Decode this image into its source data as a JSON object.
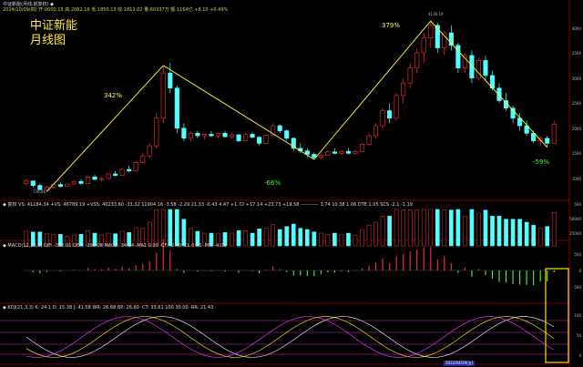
{
  "header": {
    "main_info": "中证新能(月线,前复权) ◆",
    "main_row2": "2024/10/09(四) 开:0000.15 高:2062.16 低:1850.13 收:1813.02 量:60337万 额:1164亿 +8.10 +0.49%",
    "vol_info": "◆ 复权 VS: 41184.34 +VS: 46789.19 +VSS: 40233.60 -33.32 11904.16 -3.58 -2.29 21.33 -0.43 4.47 +1.72 +17.14 +23.73 +19.58 ----------- 3.74 10.38 1.06 DTE 1.05 SCS -2.1 -1.19",
    "macd_info": "◆ MACD(12,26,9) DIF: -382.01 DEA: -399.08 MACD: 34.14 ·MA1 0.00 ·CF: -2.40 ·CL 0.00 ·MK: -4.05",
    "kdj_info": "◆ KDJ(21,3,3) K: 24.1 D: 15.38 J: 41.58 WR: 26.68 BP: 26.60 ·CT: 33.61 100 30.00 ·RR: 21.43"
  },
  "chart_title": {
    "line1": "中证新能",
    "line2": "月线图"
  },
  "annotations": {
    "up1": "342%",
    "up2": "379%",
    "down1": "-66%",
    "down2": "-59%",
    "low_label": "736.66",
    "high_label": "4136.19"
  },
  "axis": {
    "price_ticks": [
      "4000",
      "3500",
      "3000",
      "2500",
      "2000",
      "1500",
      "1000",
      "500"
    ],
    "vol_ticks": [
      "50000",
      "25000"
    ],
    "macd_ticks": [
      "500",
      "0",
      "-500"
    ],
    "kdj_ticks": [
      "100",
      "50",
      "0"
    ],
    "date_label": "2022/04/29(五)"
  },
  "colors": {
    "up": "#ff3030",
    "down": "#54ffff",
    "trend": "#ffff40",
    "grid": "#7a0000",
    "highlight": "#ffe000"
  },
  "chart_data": {
    "type": "candlestick",
    "series_ohlc_note": "monthly candles, estimated",
    "ohlc": [
      [
        900,
        1000,
        850,
        950
      ],
      [
        950,
        960,
        820,
        860
      ],
      [
        860,
        900,
        760,
        780
      ],
      [
        780,
        850,
        737,
        830
      ],
      [
        830,
        900,
        800,
        880
      ],
      [
        880,
        920,
        820,
        840
      ],
      [
        840,
        900,
        830,
        890
      ],
      [
        890,
        960,
        870,
        940
      ],
      [
        940,
        980,
        880,
        900
      ],
      [
        900,
        1050,
        890,
        1030
      ],
      [
        1030,
        1080,
        960,
        980
      ],
      [
        980,
        1020,
        930,
        1000
      ],
      [
        1000,
        1100,
        980,
        1090
      ],
      [
        1090,
        1150,
        1040,
        1060
      ],
      [
        1060,
        1200,
        1050,
        1180
      ],
      [
        1180,
        1250,
        1120,
        1150
      ],
      [
        1150,
        1350,
        1140,
        1320
      ],
      [
        1320,
        1500,
        1300,
        1450
      ],
      [
        1450,
        1700,
        1400,
        1650
      ],
      [
        1650,
        2300,
        1600,
        2200
      ],
      [
        2200,
        3250,
        2100,
        3100
      ],
      [
        3100,
        3300,
        2700,
        2800
      ],
      [
        2800,
        2850,
        1900,
        2000
      ],
      [
        2000,
        2100,
        1750,
        1800
      ],
      [
        1800,
        1950,
        1750,
        1900
      ],
      [
        1900,
        1950,
        1800,
        1850
      ],
      [
        1850,
        1900,
        1780,
        1880
      ],
      [
        1880,
        1950,
        1830,
        1850
      ],
      [
        1850,
        1920,
        1800,
        1900
      ],
      [
        1900,
        1950,
        1820,
        1830
      ],
      [
        1830,
        1900,
        1780,
        1870
      ],
      [
        1870,
        1880,
        1720,
        1750
      ],
      [
        1750,
        1900,
        1740,
        1880
      ],
      [
        1880,
        1920,
        1800,
        1820
      ],
      [
        1820,
        1840,
        1650,
        1700
      ],
      [
        1700,
        1880,
        1680,
        1860
      ],
      [
        1860,
        2100,
        1840,
        2050
      ],
      [
        2050,
        2080,
        1900,
        1950
      ],
      [
        1950,
        1980,
        1750,
        1800
      ],
      [
        1800,
        1820,
        1550,
        1600
      ],
      [
        1600,
        1700,
        1500,
        1550
      ],
      [
        1550,
        1600,
        1420,
        1480
      ],
      [
        1480,
        1520,
        1380,
        1420
      ],
      [
        1420,
        1500,
        1380,
        1460
      ],
      [
        1460,
        1550,
        1450,
        1530
      ],
      [
        1530,
        1600,
        1480,
        1500
      ],
      [
        1500,
        1560,
        1460,
        1540
      ],
      [
        1540,
        1600,
        1480,
        1500
      ],
      [
        1500,
        1560,
        1480,
        1540
      ],
      [
        1540,
        1700,
        1520,
        1680
      ],
      [
        1680,
        1900,
        1650,
        1850
      ],
      [
        1850,
        2100,
        1800,
        2050
      ],
      [
        2050,
        2400,
        2000,
        2350
      ],
      [
        2350,
        2500,
        2100,
        2200
      ],
      [
        2200,
        2700,
        2150,
        2650
      ],
      [
        2650,
        3000,
        2500,
        2900
      ],
      [
        2900,
        3300,
        2800,
        3200
      ],
      [
        3200,
        3600,
        3100,
        3500
      ],
      [
        3500,
        3900,
        3300,
        3800
      ],
      [
        3800,
        4136,
        3600,
        4050
      ],
      [
        4050,
        4100,
        3500,
        3600
      ],
      [
        3600,
        3950,
        3450,
        3900
      ],
      [
        3900,
        4050,
        3550,
        3650
      ],
      [
        3650,
        3700,
        3100,
        3200
      ],
      [
        3200,
        3500,
        3100,
        3450
      ],
      [
        3450,
        3550,
        2900,
        3000
      ],
      [
        3000,
        3400,
        2950,
        3350
      ],
      [
        3350,
        3450,
        2950,
        3050
      ],
      [
        3050,
        3150,
        2750,
        2800
      ],
      [
        2800,
        2900,
        2500,
        2550
      ],
      [
        2550,
        2700,
        2350,
        2400
      ],
      [
        2400,
        2450,
        2100,
        2200
      ],
      [
        2200,
        2300,
        1950,
        2050
      ],
      [
        2050,
        2150,
        1850,
        1900
      ],
      [
        1900,
        1950,
        1700,
        1750
      ],
      [
        1750,
        1850,
        1650,
        1800
      ],
      [
        1800,
        1850,
        1620,
        1700
      ],
      [
        1700,
        2150,
        1690,
        2080
      ]
    ],
    "ylim": [
      600,
      4300
    ]
  }
}
